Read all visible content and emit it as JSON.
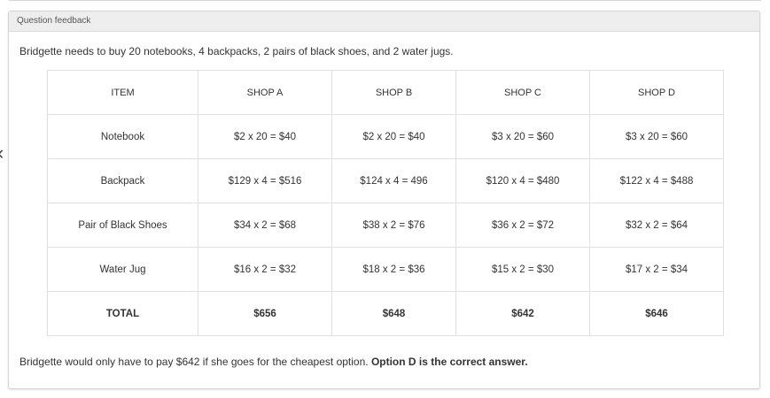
{
  "panel": {
    "title": "Question feedback"
  },
  "intro": "Bridgette needs to buy 20 notebooks, 4 backpacks, 2 pairs of black shoes, and 2 water jugs.",
  "table": {
    "headers": [
      "ITEM",
      "SHOP A",
      "SHOP B",
      "SHOP C",
      "SHOP D"
    ],
    "rows": [
      [
        "Notebook",
        "$2 x 20 = $40",
        "$2 x 20 = $40",
        "$3 x 20 = $60",
        "$3 x 20 = $60"
      ],
      [
        "Backpack",
        "$129 x 4 = $516",
        "$124 x 4 = 496",
        "$120 x 4 = $480",
        "$122 x 4 = $488"
      ],
      [
        "Pair of Black Shoes",
        "$34 x 2 = $68",
        "$38 x 2 = $76",
        "$36 x 2 = $72",
        "$32 x 2 = $64"
      ],
      [
        "Water Jug",
        "$16 x 2 = $32",
        "$18 x 2 = $36",
        "$15 x 2 = $30",
        "$17 x 2 = $34"
      ]
    ],
    "total": [
      "TOTAL",
      "$656",
      "$648",
      "$642",
      "$646"
    ]
  },
  "conclusion": {
    "text": "Bridgette would only have to pay $642 if she goes for the cheapest option. ",
    "bold": "Option D is the correct answer."
  },
  "icons": {
    "left_nav": "chevron-left-icon"
  }
}
